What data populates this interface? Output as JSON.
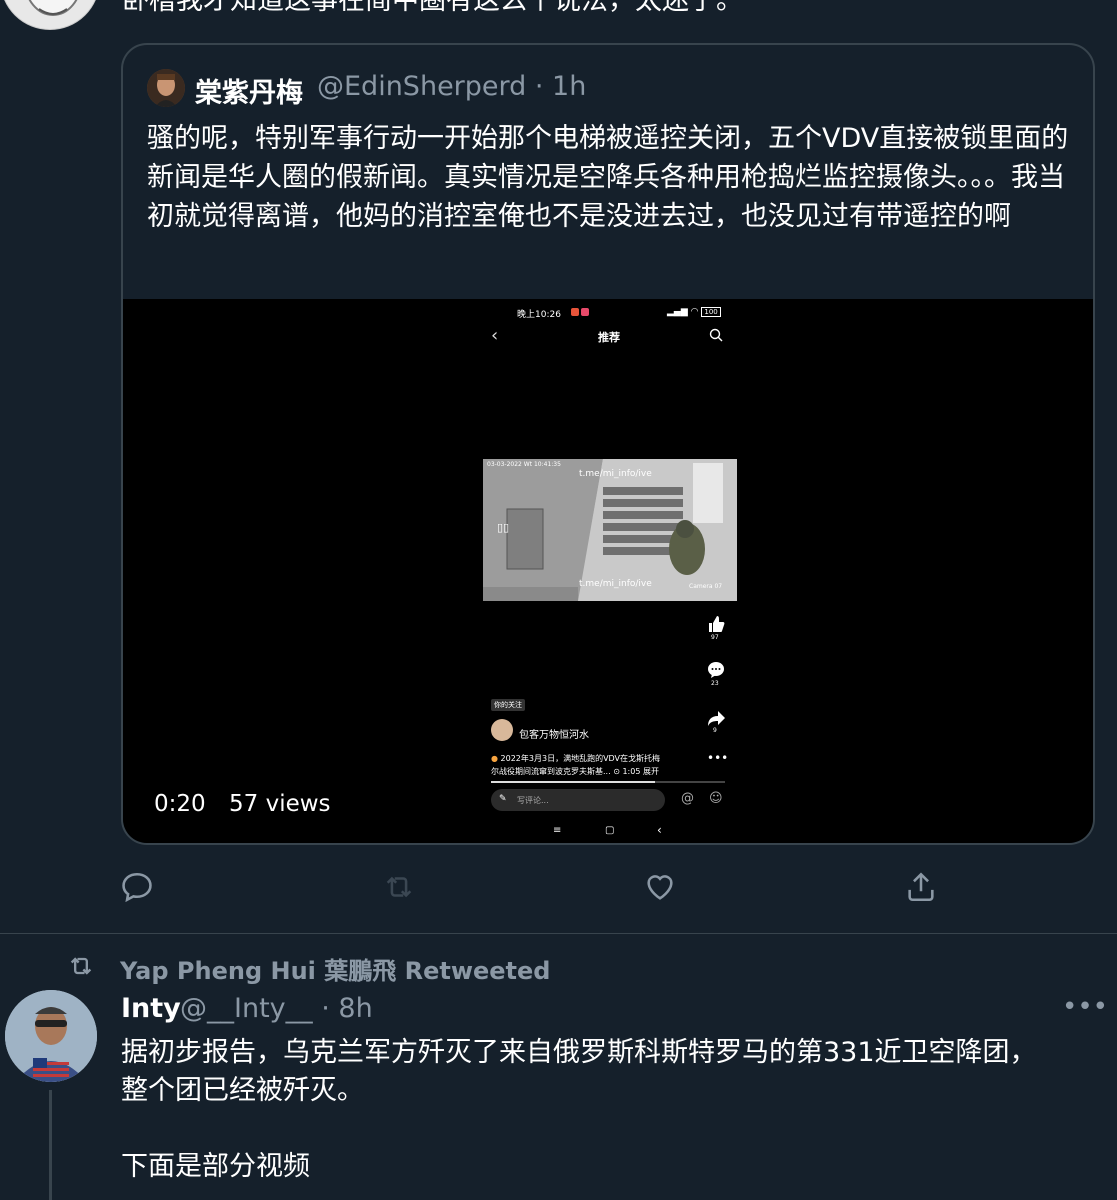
{
  "top_tweet": {
    "text": "卧槽我才知道这事在简中圈有这么个说法，太迷了。"
  },
  "quoted_tweet": {
    "author_name": "棠紫丹梅",
    "author_handle": "@EdinSherperd",
    "time": "· 1h",
    "text": "骚的呢，特别军事行动一开始那个电梯被遥控关闭，五个VDV直接被锁里面的新闻是华人圈的假新闻。真实情况是空降兵各种用枪捣烂监控摄像头。。。我当初就觉得离谱，他妈的消控室俺也不是没进去过，也没见过有带遥控的啊",
    "video": {
      "duration": "0:20",
      "views": "57 views",
      "phone": {
        "status_time": "晚上10:26",
        "status_battery": "100",
        "nav_title": "推荐",
        "cctv_timestamp": "03-03-2022 Wt 10:41:35",
        "cctv_watermark_top": "t.me/mi_info/ive",
        "cctv_watermark_bottom": "t.me/mi_info/ive",
        "cctv_camera": "Camera 07",
        "like_count": "97",
        "comment_count": "23",
        "share_count": "9",
        "follow_badge": "你的关注",
        "channel_name": "包客万物恒河水",
        "caption_line1": "2022年3月3日，满地乱跑的VDV在戈斯托梅",
        "caption_line2": "尔战役期间流窜到波克罗夫斯基...",
        "caption_duration": "1:05",
        "caption_expand": "展开",
        "comment_placeholder": "写评论..."
      }
    }
  },
  "actions": {
    "reply": "reply-icon",
    "retweet": "retweet-icon",
    "like": "heart-icon",
    "share": "share-icon"
  },
  "retweet_banner": {
    "text": "Yap Pheng Hui 葉鵬飛 Retweeted"
  },
  "second_tweet": {
    "author_name": "Inty",
    "author_handle": "@__Inty__",
    "time": "· 8h",
    "more": "•••",
    "text": "据初步报告，乌克兰军方歼灭了来自俄罗斯科斯特罗马的第331近卫空降团，\n整个团已经被歼灭。\n\n下面是部分视频"
  },
  "colors": {
    "background": "#15202b",
    "border": "#38444d",
    "secondary_text": "#8b98a5"
  }
}
